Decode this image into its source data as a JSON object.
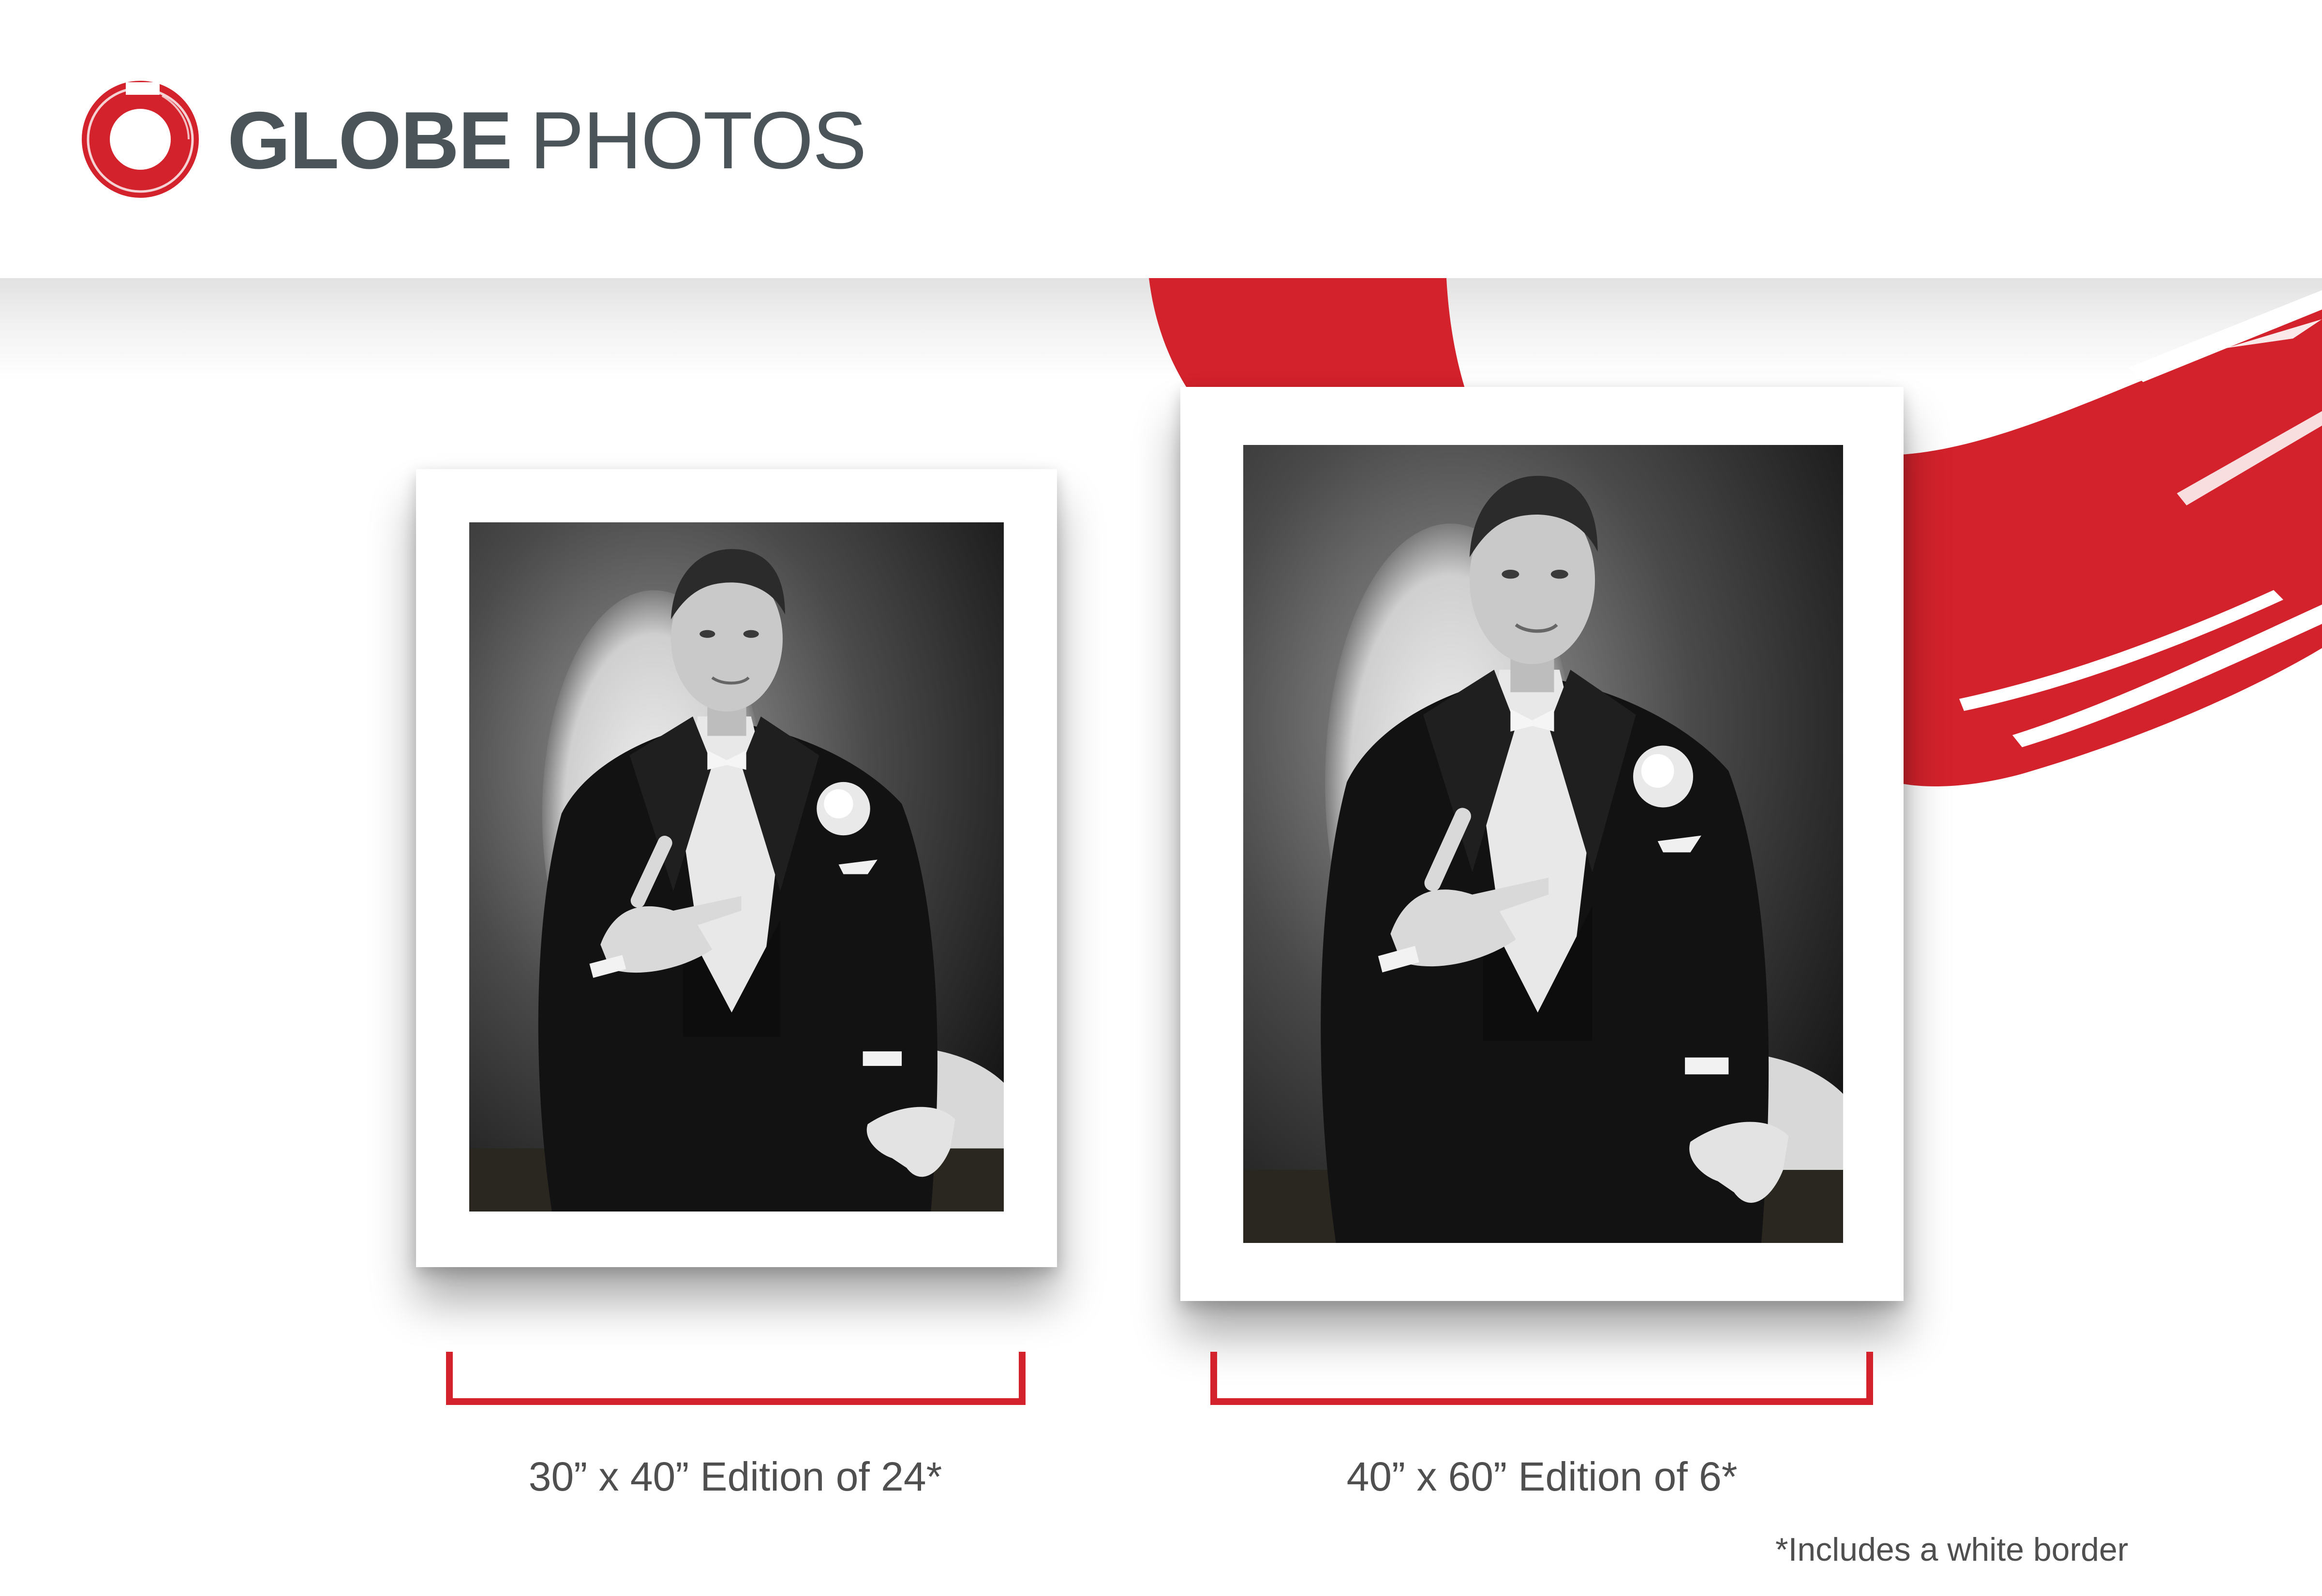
{
  "brand": {
    "logo_text_bold": "GLOBE",
    "logo_text_light": "PHOTOS",
    "accent_color": "#d3222c",
    "text_color": "#4b5459"
  },
  "editions": [
    {
      "caption": "30” x 40” Edition of 24*"
    },
    {
      "caption": "40” x 60” Edition of 6*"
    }
  ],
  "footnote": "*Includes a white border",
  "photo": {
    "description_icon": "black-and-white-portrait-tuxedo"
  }
}
